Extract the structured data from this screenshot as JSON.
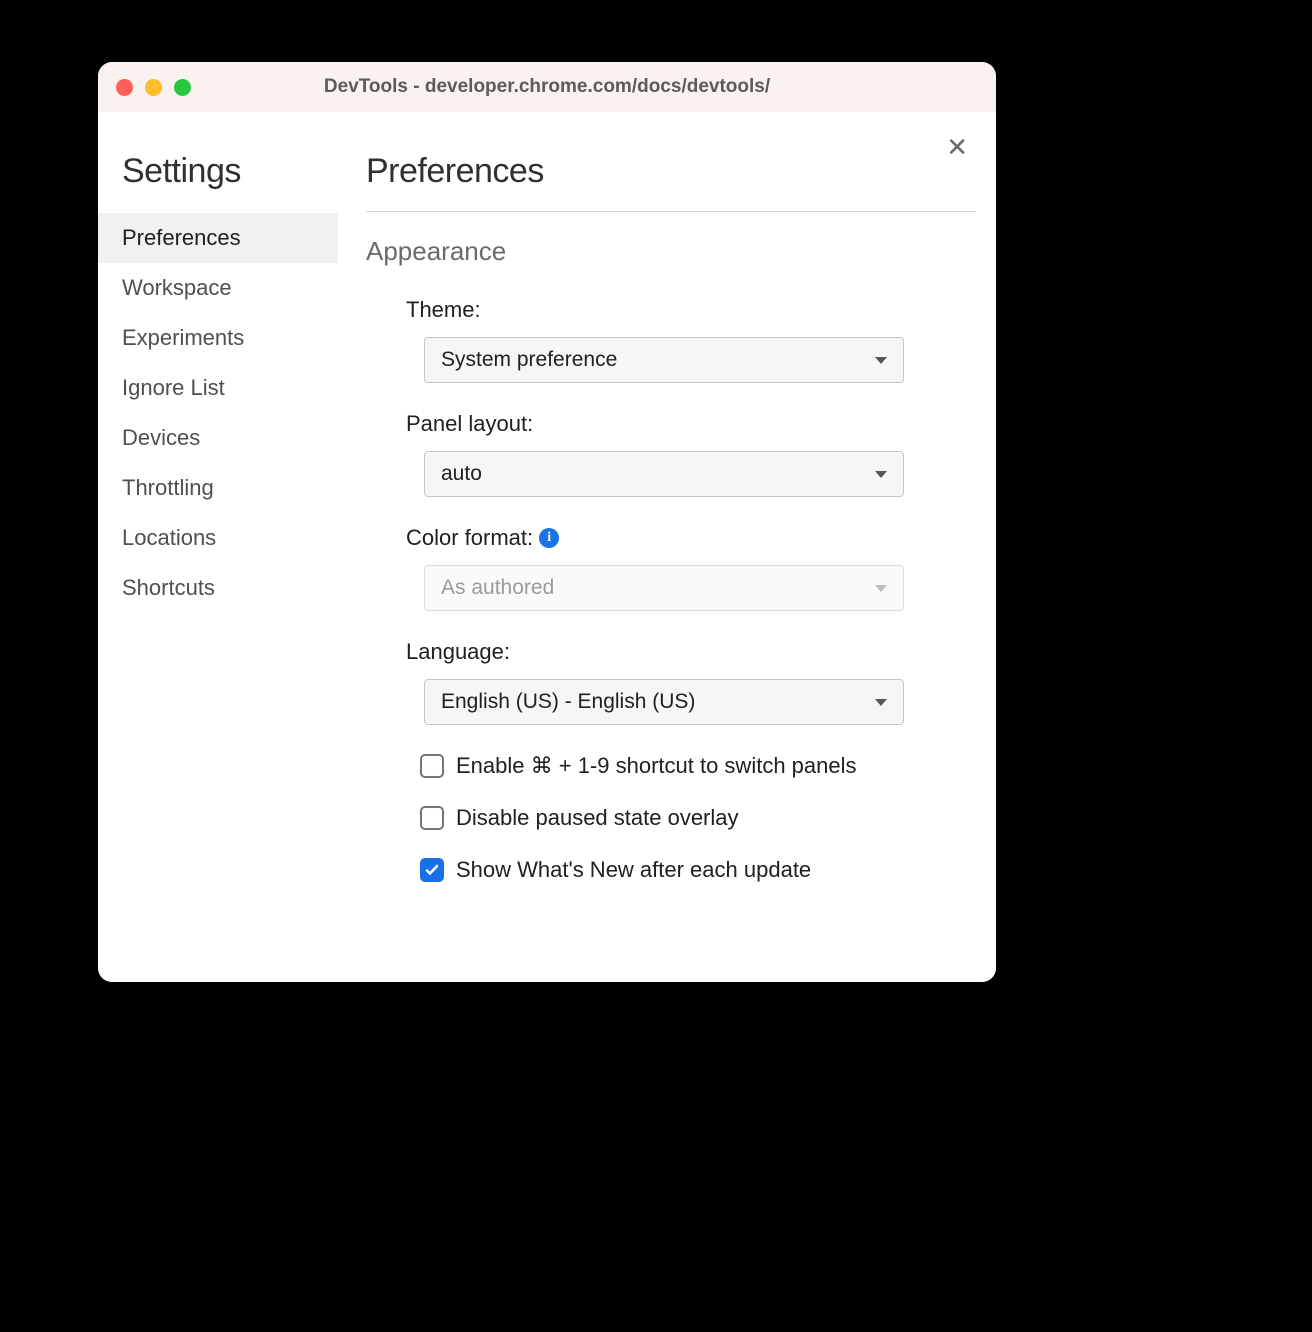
{
  "window": {
    "title": "DevTools - developer.chrome.com/docs/devtools/"
  },
  "sidebar": {
    "title": "Settings",
    "items": [
      {
        "label": "Preferences",
        "active": true
      },
      {
        "label": "Workspace",
        "active": false
      },
      {
        "label": "Experiments",
        "active": false
      },
      {
        "label": "Ignore List",
        "active": false
      },
      {
        "label": "Devices",
        "active": false
      },
      {
        "label": "Throttling",
        "active": false
      },
      {
        "label": "Locations",
        "active": false
      },
      {
        "label": "Shortcuts",
        "active": false
      }
    ]
  },
  "main": {
    "title": "Preferences",
    "section_title": "Appearance",
    "fields": {
      "theme": {
        "label": "Theme:",
        "value": "System preference"
      },
      "panel_layout": {
        "label": "Panel layout:",
        "value": "auto"
      },
      "color_format": {
        "label": "Color format:",
        "value": "As authored",
        "disabled": true
      },
      "language": {
        "label": "Language:",
        "value": "English (US) - English (US)"
      }
    },
    "checkboxes": [
      {
        "label": "Enable ⌘ + 1-9 shortcut to switch panels",
        "checked": false
      },
      {
        "label": "Disable paused state overlay",
        "checked": false
      },
      {
        "label": "Show What's New after each update",
        "checked": true
      }
    ]
  }
}
